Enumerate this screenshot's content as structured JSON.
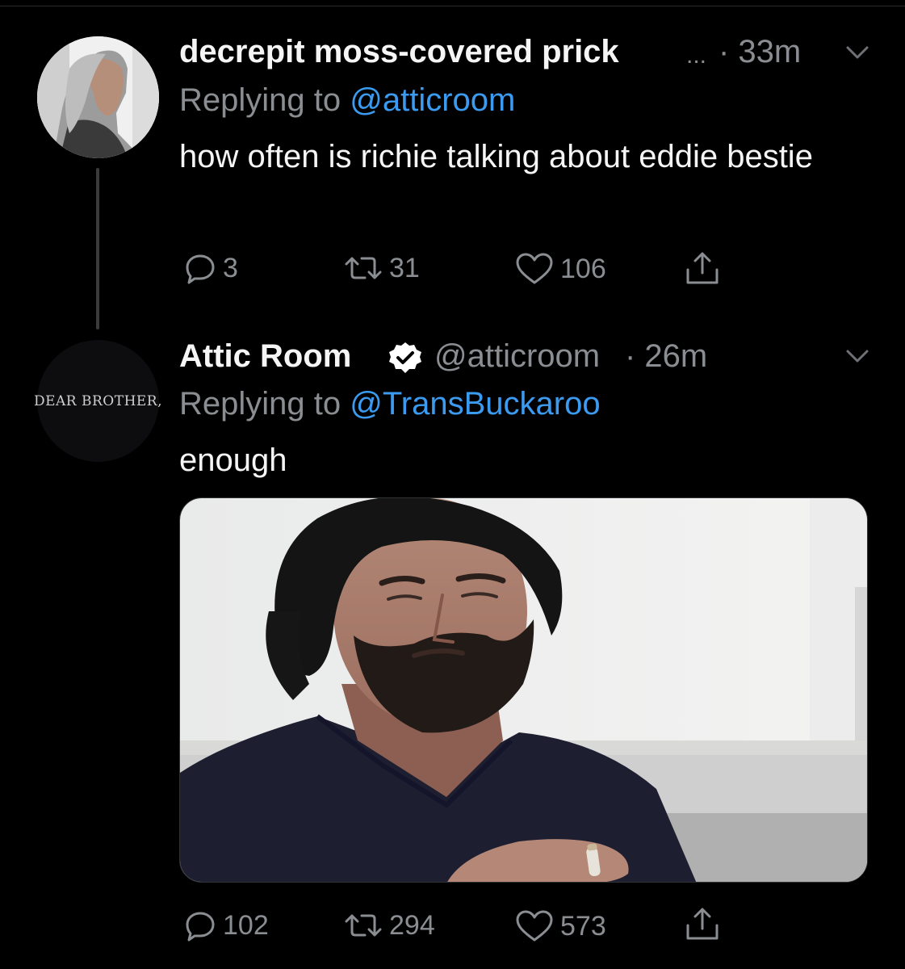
{
  "tweet1": {
    "display_name": "decrepit moss-covered prick",
    "ellipsis": "...",
    "time": "· 33m",
    "replying_prefix": "Replying to",
    "replying_handle": "@atticroom",
    "text": "how often is richie talking about eddie bestie",
    "replies": "3",
    "retweets": "31",
    "likes": "106"
  },
  "tweet2": {
    "display_name": "Attic Room",
    "handle": "@atticroom",
    "time": "· 26m",
    "avatar_text": "DEAR BROTHER,",
    "replying_prefix": "Replying to",
    "replying_handle": "@TransBuckaroo",
    "text": "enough",
    "replies": "102",
    "retweets": "294",
    "likes": "573"
  },
  "colors": {
    "background": "#000000",
    "text": "#f5f5f5",
    "secondary": "#8a8d91",
    "link": "#3b9bf0"
  },
  "icons": [
    "reply-icon",
    "retweet-icon",
    "like-icon",
    "share-icon",
    "chevron-down-icon",
    "verified-badge-icon"
  ]
}
